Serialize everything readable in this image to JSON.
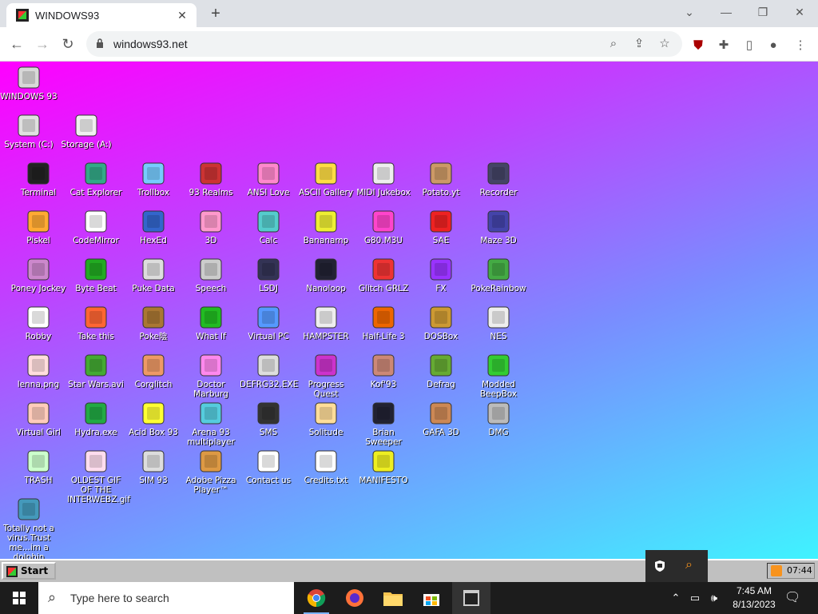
{
  "browser": {
    "tab_title": "WINDOWS93",
    "url": "windows93.net"
  },
  "desktop_icons": [
    {
      "label": "WINDOWS 93"
    },
    {
      "label": "System (C:)"
    },
    {
      "label": "Storage (A:)"
    },
    {
      "label": "Terminal"
    },
    {
      "label": "Cat Explorer"
    },
    {
      "label": "Trollbox"
    },
    {
      "label": "93 Realms"
    },
    {
      "label": "ANSI Love"
    },
    {
      "label": "ASCII Gallery"
    },
    {
      "label": "MIDI Jukebox"
    },
    {
      "label": "Potato.yt"
    },
    {
      "label": "Recorder"
    },
    {
      "label": "Piskel"
    },
    {
      "label": "CodeMirror"
    },
    {
      "label": "HexEd"
    },
    {
      "label": "3D"
    },
    {
      "label": "Calc"
    },
    {
      "label": "Bananamp"
    },
    {
      "label": "G80.M3U"
    },
    {
      "label": "SAE"
    },
    {
      "label": "Maze 3D"
    },
    {
      "label": "Poney Jockey"
    },
    {
      "label": "Byte Beat"
    },
    {
      "label": "Puke Data"
    },
    {
      "label": "Speech"
    },
    {
      "label": "LSDJ"
    },
    {
      "label": "Nanoloop"
    },
    {
      "label": "Glitch GRLZ"
    },
    {
      "label": "FX"
    },
    {
      "label": "PokeRainbow"
    },
    {
      "label": "Robby"
    },
    {
      "label": "Take this"
    },
    {
      "label": "Poke陰"
    },
    {
      "label": "What If"
    },
    {
      "label": "Virtual PC"
    },
    {
      "label": "HAMPSTER"
    },
    {
      "label": "Half-Life 3"
    },
    {
      "label": "DOSBox"
    },
    {
      "label": "NES"
    },
    {
      "label": "lenna.png"
    },
    {
      "label": "Star Wars.avi"
    },
    {
      "label": "Corglitch"
    },
    {
      "label": "Doctor Marburg"
    },
    {
      "label": "DEFRG32.EXE"
    },
    {
      "label": "Progress Quest"
    },
    {
      "label": "Kof'93"
    },
    {
      "label": "Defrag"
    },
    {
      "label": "Modded BeepBox"
    },
    {
      "label": "Virtual Girl"
    },
    {
      "label": "Hydra.exe"
    },
    {
      "label": "Acid Box 93"
    },
    {
      "label": "Arena 93 multiplayer"
    },
    {
      "label": "SMS"
    },
    {
      "label": "Solitude"
    },
    {
      "label": "Brian Sweeper"
    },
    {
      "label": "GAFA 3D"
    },
    {
      "label": "DMG"
    },
    {
      "label": "TRASH"
    },
    {
      "label": "OLDEST GIF OF THE INTERWEBZ.gif"
    },
    {
      "label": "SIM 93"
    },
    {
      "label": "Adobe Pizza Player™"
    },
    {
      "label": "Contact us"
    },
    {
      "label": "Credits.txt"
    },
    {
      "label": "MANIFESTO"
    },
    {
      "label": "Totally not a virus.Trust me...im a dolphin"
    }
  ],
  "taskbar93": {
    "start_label": "Start",
    "clock": "07:44"
  },
  "windows_taskbar": {
    "search_placeholder": "Type here to search",
    "time": "7:45 AM",
    "date": "8/13/2023"
  }
}
